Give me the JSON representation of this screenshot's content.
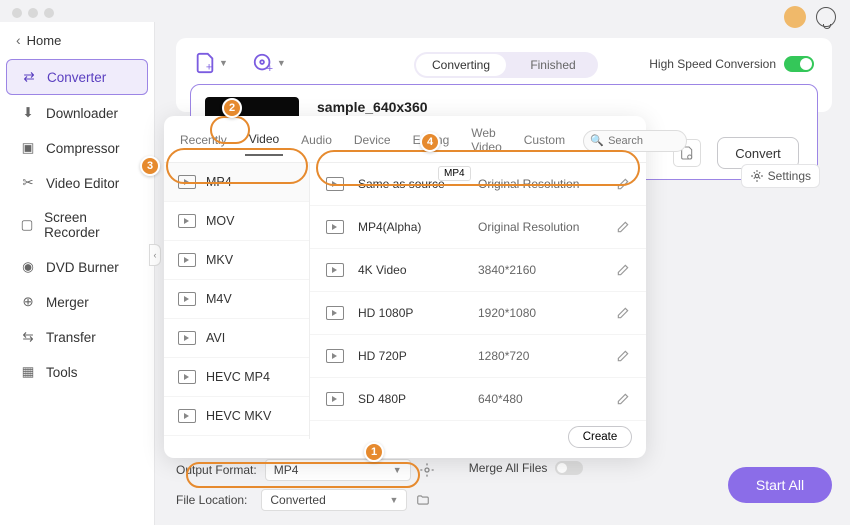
{
  "colors": {
    "accent": "#8b6de8",
    "hint": "#e68a2e",
    "toggle_on": "#34c759"
  },
  "header": {
    "home": "Home"
  },
  "sidebar": {
    "items": [
      {
        "label": "Converter"
      },
      {
        "label": "Downloader"
      },
      {
        "label": "Compressor"
      },
      {
        "label": "Video Editor"
      },
      {
        "label": "Screen Recorder"
      },
      {
        "label": "DVD Burner"
      },
      {
        "label": "Merger"
      },
      {
        "label": "Transfer"
      },
      {
        "label": "Tools"
      }
    ]
  },
  "toolbar": {
    "seg_converting": "Converting",
    "seg_finished": "Finished",
    "hsc": "High Speed Conversion"
  },
  "file": {
    "title": "sample_640x360",
    "convert": "Convert",
    "settings": "Settings"
  },
  "popup": {
    "tabs": {
      "recently": "Recently",
      "video": "Video",
      "audio": "Audio",
      "device": "Device",
      "editing": "Editing",
      "webvideo": "Web Video",
      "custom": "Custom"
    },
    "search_placeholder": "Search",
    "tag": "MP4",
    "formats": [
      {
        "label": "MP4"
      },
      {
        "label": "MOV"
      },
      {
        "label": "MKV"
      },
      {
        "label": "M4V"
      },
      {
        "label": "AVI"
      },
      {
        "label": "HEVC MP4"
      },
      {
        "label": "HEVC MKV"
      }
    ],
    "options": [
      {
        "name": "Same as source",
        "res": "Original Resolution"
      },
      {
        "name": "MP4(Alpha)",
        "res": "Original Resolution"
      },
      {
        "name": "4K Video",
        "res": "3840*2160"
      },
      {
        "name": "HD 1080P",
        "res": "1920*1080"
      },
      {
        "name": "HD 720P",
        "res": "1280*720"
      },
      {
        "name": "SD 480P",
        "res": "640*480"
      }
    ],
    "create": "Create"
  },
  "bottom": {
    "output_label": "Output Format:",
    "output_value": "MP4",
    "loc_label": "File Location:",
    "loc_value": "Converted",
    "merge": "Merge All Files",
    "start": "Start All"
  },
  "hints": {
    "h1": "1",
    "h2": "2",
    "h3": "3",
    "h4": "4"
  }
}
